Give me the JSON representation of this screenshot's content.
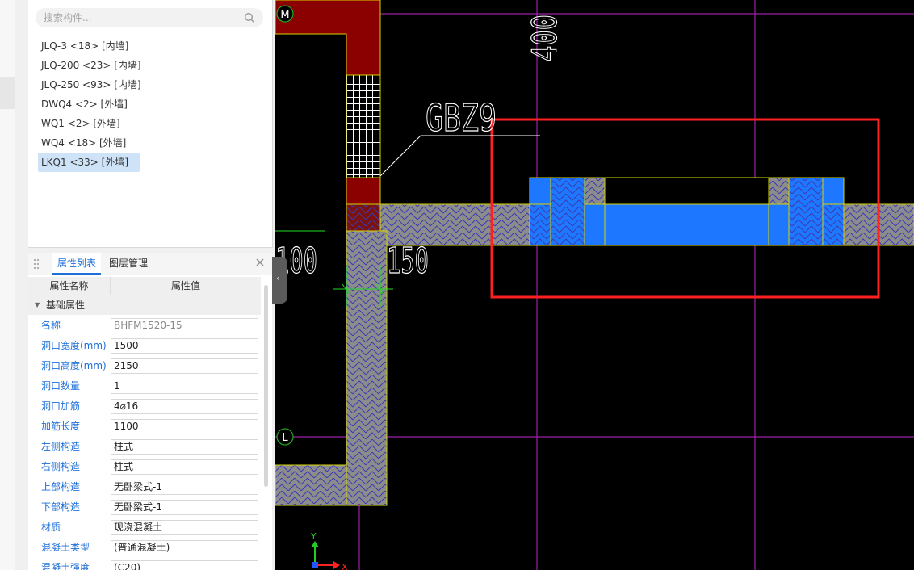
{
  "search": {
    "placeholder": "搜索构件..."
  },
  "components": [
    {
      "label": "JLQ-3 <18> [内墙]"
    },
    {
      "label": "JLQ-200 <23> [内墙]"
    },
    {
      "label": "JLQ-250 <93> [内墙]"
    },
    {
      "label": "DWQ4 <2> [外墙]"
    },
    {
      "label": "WQ1 <2> [外墙]"
    },
    {
      "label": "WQ4 <18> [外墙]"
    },
    {
      "label": "LKQ1 <33> [外墙]",
      "selected": true
    }
  ],
  "props": {
    "tabs": [
      {
        "label": "属性列表",
        "active": true
      },
      {
        "label": "图层管理"
      }
    ],
    "header": {
      "name": "属性名称",
      "value": "属性值"
    },
    "group": "基础属性",
    "rows": [
      {
        "name": "名称",
        "value": "BHFM1520-15",
        "muted": true
      },
      {
        "name": "洞口宽度(mm)",
        "value": "1500"
      },
      {
        "name": "洞口高度(mm)",
        "value": "2150"
      },
      {
        "name": "洞口数量",
        "value": "1"
      },
      {
        "name": "洞口加筋",
        "value": "4⌀16"
      },
      {
        "name": "加筋长度",
        "value": "1100"
      },
      {
        "name": "左侧构造",
        "value": "柱式"
      },
      {
        "name": "右侧构造",
        "value": "柱式"
      },
      {
        "name": "上部构造",
        "value": "无卧梁式-1"
      },
      {
        "name": "下部构造",
        "value": "无卧梁式-1"
      },
      {
        "name": "材质",
        "value": "现浇混凝土"
      },
      {
        "name": "混凝土类型",
        "value": "(普通混凝土)"
      },
      {
        "name": "混凝土强度",
        "value": "(C20)"
      }
    ]
  },
  "cad": {
    "axis_labels": {
      "top": "M",
      "bottom": "L"
    },
    "dims": {
      "d400": "400",
      "d100": "100",
      "d150": "150"
    },
    "tag": "GBZ9",
    "coord": {
      "x": "X",
      "y": "Y"
    },
    "colors": {
      "background": "#000000",
      "column": "#8b0000",
      "wall": "#8c8c8c",
      "opening": "#1e78ff",
      "highlight": "#ff2020",
      "grid": "#9b1fa5"
    }
  }
}
